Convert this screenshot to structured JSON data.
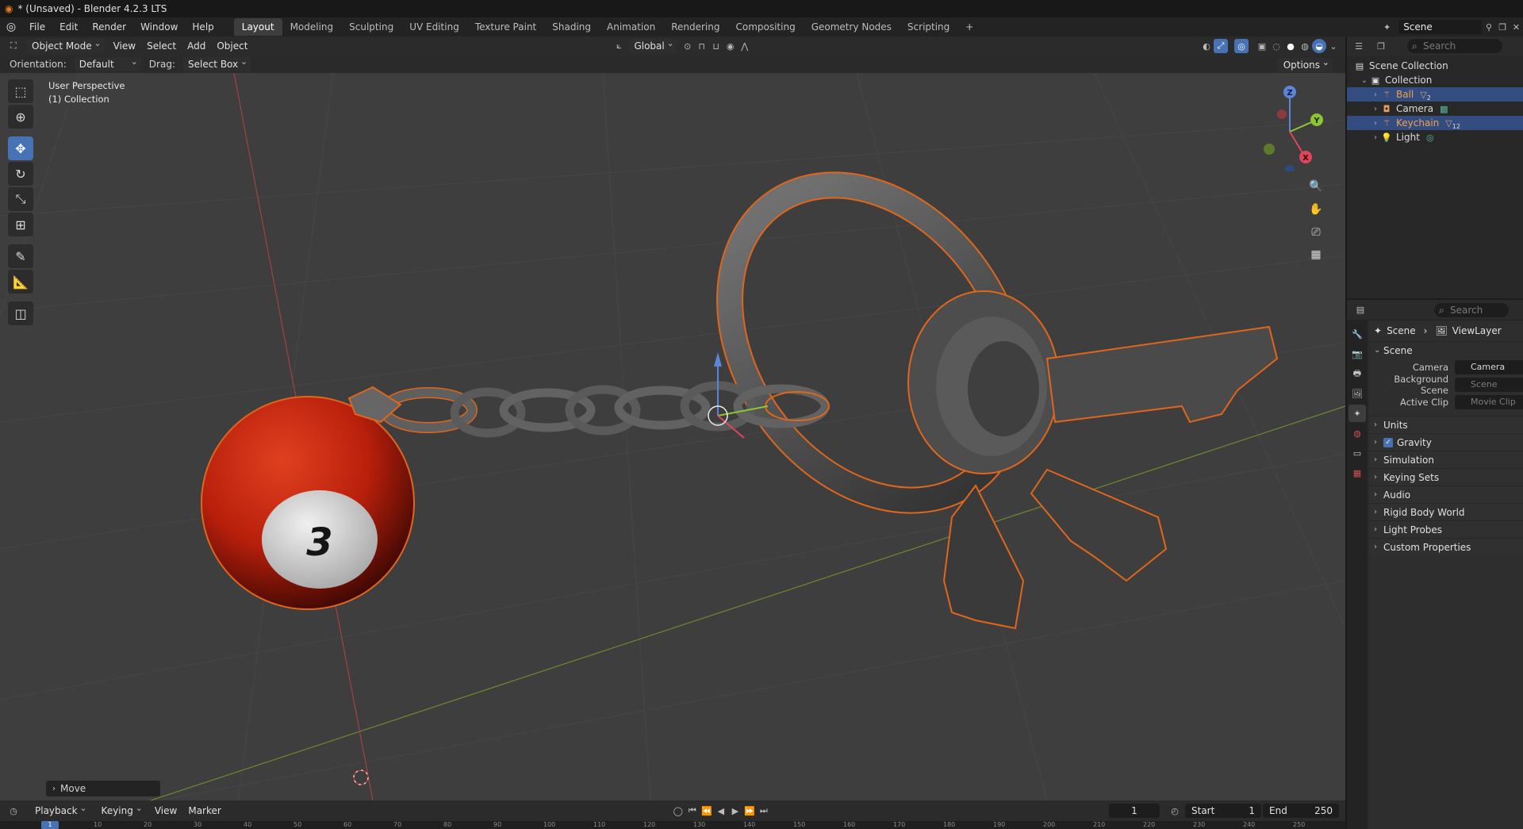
{
  "window": {
    "title": "* (Unsaved) - Blender 4.2.3 LTS"
  },
  "menu": [
    "File",
    "Edit",
    "Render",
    "Window",
    "Help"
  ],
  "workspaces": [
    "Layout",
    "Modeling",
    "Sculpting",
    "UV Editing",
    "Texture Paint",
    "Shading",
    "Animation",
    "Rendering",
    "Compositing",
    "Geometry Nodes",
    "Scripting"
  ],
  "add_workspace": "+",
  "scene_selector": {
    "value": "Scene"
  },
  "viewport": {
    "mode": "Object Mode",
    "menus": [
      "View",
      "Select",
      "Add",
      "Object"
    ],
    "transform_orientation": "Global",
    "orientation_label": "Orientation:",
    "orientation_value": "Default",
    "drag_label": "Drag:",
    "drag_value": "Select Box",
    "options_label": "Options",
    "info_line1": "User Perspective",
    "info_line2": "(1) Collection",
    "last_operator": "Move",
    "ball_number": "3",
    "colors": {
      "background": "#3e3e3e",
      "selection_outline": "#e0661b",
      "ball_red": "#c0230e"
    }
  },
  "gizmo": {
    "x": "X",
    "y": "Y",
    "z": "Z"
  },
  "timeline": {
    "menus": [
      "Playback",
      "Keying",
      "View",
      "Marker"
    ],
    "current_frame": "1",
    "start_label": "Start",
    "start_value": "1",
    "end_label": "End",
    "end_value": "250",
    "ruler_current": "1",
    "ruler_ticks": [
      "10",
      "20",
      "30",
      "40",
      "50",
      "60",
      "70",
      "80",
      "90",
      "100",
      "110",
      "120",
      "130",
      "140",
      "150",
      "160",
      "170",
      "180",
      "190",
      "200",
      "210",
      "220",
      "230",
      "240",
      "250"
    ]
  },
  "outliner": {
    "search_placeholder": "Search",
    "root": "Scene Collection",
    "collection": "Collection",
    "items": [
      {
        "name": "Ball",
        "selected": true,
        "modifier": "2"
      },
      {
        "name": "Camera",
        "selected": false,
        "modifier": ""
      },
      {
        "name": "Keychain",
        "selected": true,
        "modifier": "12"
      },
      {
        "name": "Light",
        "selected": false,
        "modifier": ""
      }
    ]
  },
  "properties": {
    "search_placeholder": "Search",
    "breadcrumb_scene": "Scene",
    "breadcrumb_layer": "ViewLayer",
    "panel_title": "Scene",
    "fields": [
      {
        "label": "Camera",
        "value": "Camera",
        "dim": false
      },
      {
        "label": "Background Scene",
        "value": "Scene",
        "dim": true
      },
      {
        "label": "Active Clip",
        "value": "Movie Clip",
        "dim": true
      }
    ],
    "panels": [
      "Units",
      "Gravity",
      "Simulation",
      "Keying Sets",
      "Audio",
      "Rigid Body World",
      "Light Probes",
      "Custom Properties"
    ]
  }
}
